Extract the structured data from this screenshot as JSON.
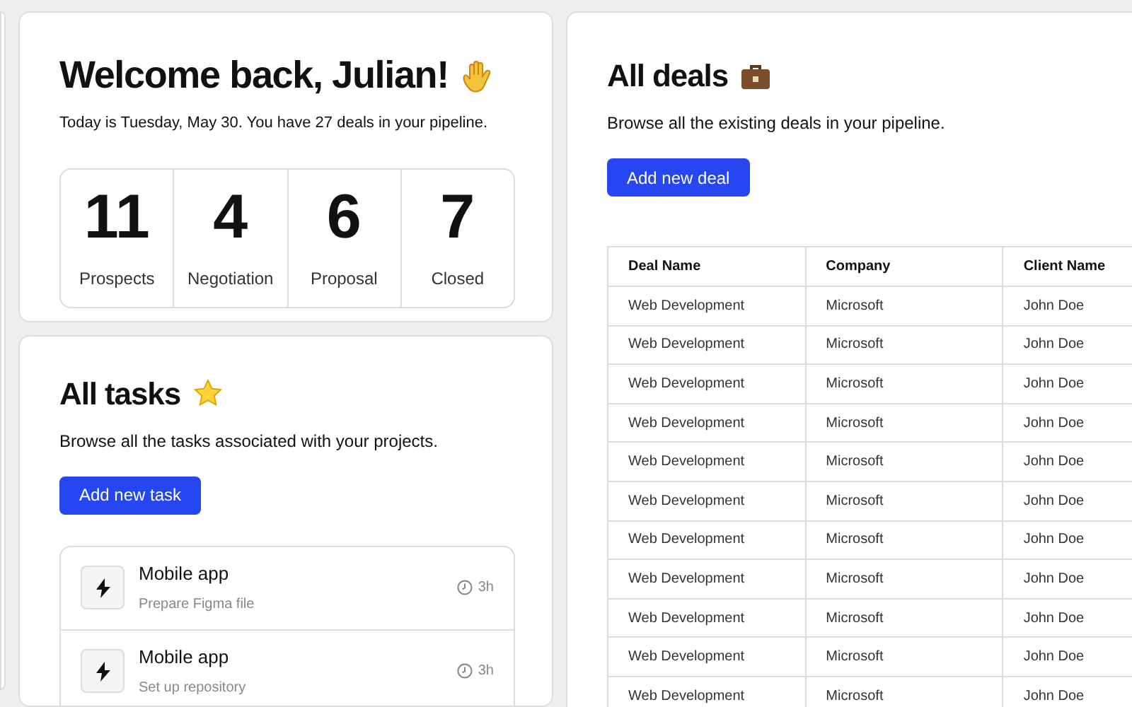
{
  "welcome": {
    "title": "Welcome back, Julian!",
    "subtitle": "Today is Tuesday, May 30. You have 27 deals in your pipeline.",
    "stats": [
      {
        "value": "11",
        "label": "Prospects"
      },
      {
        "value": "4",
        "label": "Negotiation"
      },
      {
        "value": "6",
        "label": "Proposal"
      },
      {
        "value": "7",
        "label": "Closed"
      }
    ]
  },
  "tasks": {
    "title": "All tasks",
    "subtitle": "Browse all the tasks associated with your projects.",
    "button": "Add new task",
    "items": [
      {
        "project": "Mobile app",
        "task": "Prepare Figma file",
        "duration": "3h"
      },
      {
        "project": "Mobile app",
        "task": "Set up repository",
        "duration": "3h"
      }
    ]
  },
  "deals": {
    "title": "All deals",
    "subtitle": "Browse all the existing deals in your pipeline.",
    "button": "Add new deal",
    "table": {
      "columns": [
        "Deal Name",
        "Company",
        "Client Name"
      ],
      "rows": [
        [
          "Web Development",
          "Microsoft",
          "John Doe"
        ],
        [
          "Web Development",
          "Microsoft",
          "John Doe"
        ],
        [
          "Web Development",
          "Microsoft",
          "John Doe"
        ],
        [
          "Web Development",
          "Microsoft",
          "John Doe"
        ],
        [
          "Web Development",
          "Microsoft",
          "John Doe"
        ],
        [
          "Web Development",
          "Microsoft",
          "John Doe"
        ],
        [
          "Web Development",
          "Microsoft",
          "John Doe"
        ],
        [
          "Web Development",
          "Microsoft",
          "John Doe"
        ],
        [
          "Web Development",
          "Microsoft",
          "John Doe"
        ],
        [
          "Web Development",
          "Microsoft",
          "John Doe"
        ],
        [
          "Web Development",
          "Microsoft",
          "John Doe"
        ]
      ]
    }
  }
}
